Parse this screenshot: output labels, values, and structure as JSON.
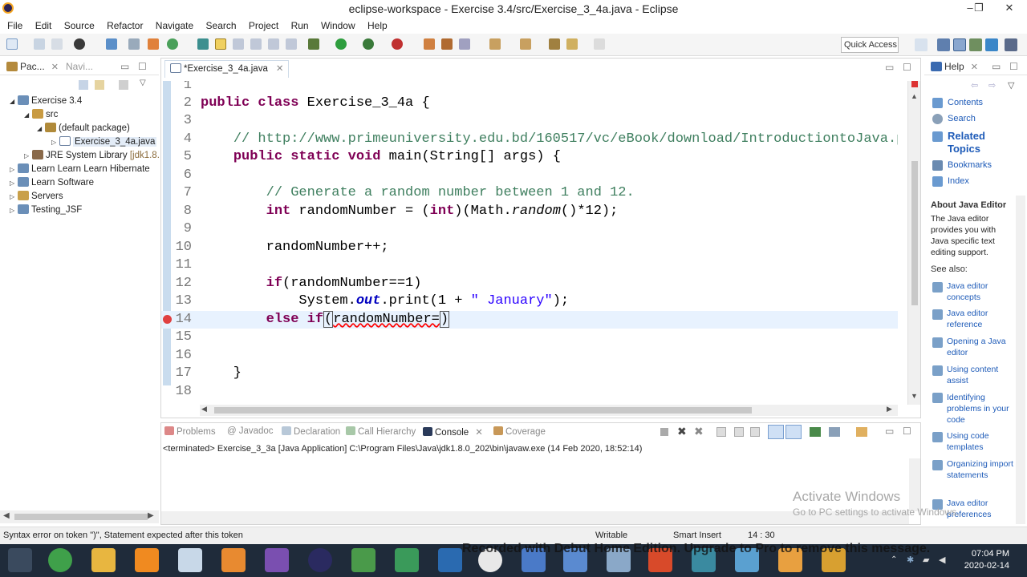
{
  "window": {
    "title": "eclipse-workspace - Exercise 3.4/src/Exercise_3_4a.java - Eclipse",
    "minimize": "–",
    "maximize": "❐",
    "close": "✕"
  },
  "menu": [
    "File",
    "Edit",
    "Source",
    "Refactor",
    "Navigate",
    "Search",
    "Project",
    "Run",
    "Window",
    "Help"
  ],
  "toolbar": {
    "quick_access": "Quick Access"
  },
  "left_panel": {
    "tabs": [
      "Pac...",
      "Navi..."
    ],
    "tree": [
      {
        "label": "Exercise 3.4",
        "level": 0,
        "expanded": true
      },
      {
        "label": "src",
        "level": 1,
        "expanded": true
      },
      {
        "label": "(default package)",
        "level": 2,
        "expanded": true
      },
      {
        "label": "Exercise_3_4a.java",
        "level": 3,
        "expanded": false
      },
      {
        "label": "JRE System Library",
        "suffix": "[jdk1.8.",
        "level": 1,
        "expanded": false
      },
      {
        "label": "Learn Learn Learn Hibernate",
        "level": 0,
        "expanded": false
      },
      {
        "label": "Learn Software",
        "level": 0,
        "expanded": false
      },
      {
        "label": "Servers",
        "level": 0,
        "expanded": false
      },
      {
        "label": "Testing_JSF",
        "level": 0,
        "expanded": false
      }
    ]
  },
  "editor": {
    "tab": "*Exercise_3_4a.java",
    "line_numbers": [
      "1",
      "2",
      "3",
      "4",
      "5",
      "6",
      "7",
      "8",
      "9",
      "10",
      "11",
      "12",
      "13",
      "14",
      "15",
      "16",
      "17",
      "18"
    ]
  },
  "bottom_panel": {
    "tabs": [
      "Problems",
      "Javadoc",
      "Declaration",
      "Call Hierarchy",
      "Console",
      "Coverage"
    ],
    "active_tab": "Console",
    "console_line": "<terminated> Exercise_3_3a [Java Application] C:\\Program Files\\Java\\jdk1.8.0_202\\bin\\javaw.exe (14 Feb 2020, 18:52:14)"
  },
  "help_panel": {
    "tab": "Help",
    "links": [
      "Contents",
      "Search",
      "Related Topics",
      "Bookmarks",
      "Index"
    ],
    "about_title": "About Java Editor",
    "about_text": "The Java editor provides you with Java specific text editing support.",
    "see_also": "See also:",
    "see_also_links": [
      "Java editor concepts",
      "Java editor reference",
      "Opening a Java editor",
      "Using content assist",
      "Identifying problems in your code",
      "Using code templates",
      "Organizing import statements",
      "Java editor preferences"
    ]
  },
  "status": {
    "message": "Syntax error on token \")\", Statement expected after this token",
    "writable": "Writable",
    "insert_mode": "Smart Insert",
    "position": "14 : 30"
  },
  "overlay": {
    "activate_title": "Activate Windows",
    "activate_sub": "Go to PC settings to activate Windows.",
    "recorder": "Recorded with Debut Home Edition. Upgrade to Pro to remove this message."
  },
  "taskbar": {
    "time": "07:04 PM",
    "date": "2020-02-14"
  },
  "colors": {
    "keyword": "#7f0055",
    "comment": "#3f7f5f",
    "string": "#2a00ff",
    "link": "#1e5bb8",
    "taskbar": "#1f2b3a"
  }
}
